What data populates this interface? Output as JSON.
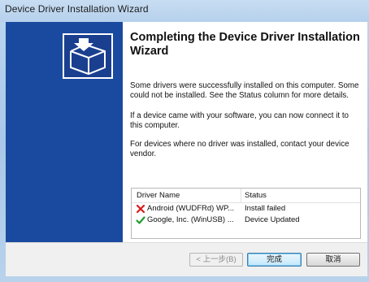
{
  "window": {
    "title": "Device Driver Installation Wizard"
  },
  "content": {
    "heading": "Completing the Device Driver Installation Wizard",
    "paragraph1": "Some drivers were successfully installed on this computer. Some could not be installed. See the Status column for more details.",
    "paragraph2": "If a device came with your software, you can now connect it to this computer.",
    "paragraph3": "For devices where no driver was installed, contact your device vendor."
  },
  "table": {
    "headers": [
      "Driver Name",
      "Status"
    ],
    "rows": [
      {
        "name": "Android (WUDFRd) WP...",
        "status": "Install failed",
        "icon": "red-x-icon"
      },
      {
        "name": "Google, Inc. (WinUSB) ...",
        "status": "Device Updated",
        "icon": "green-check-icon"
      }
    ]
  },
  "buttons": {
    "back": "< 上一步(B)",
    "finish": "完成",
    "cancel": "取消"
  },
  "colors": {
    "sidebar": "#1a4aa0",
    "error": "#d81e1e",
    "success": "#1f9e2f"
  }
}
